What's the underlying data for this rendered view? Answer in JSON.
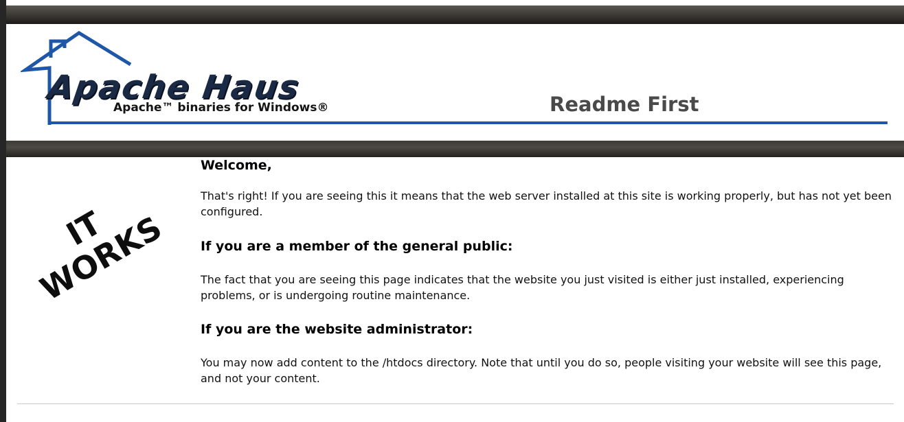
{
  "header": {
    "logo_name": "Apache Haus",
    "logo_tagline": "Apache™ binaries for Windows®",
    "title": "Readme First"
  },
  "badge": {
    "line1": "IT",
    "line2": "WORKS"
  },
  "content": {
    "welcome": "Welcome,",
    "intro": "That's right! If you are seeing this it means that the web server installed at this site is working properly, but has not yet been configured.",
    "public_heading": "If you are a member of the general public:",
    "public_text": "The fact that you are seeing this page indicates that the website you just visited is either just installed, experiencing problems, or is undergoing routine maintenance.",
    "admin_heading": "If you are the website administrator:",
    "admin_text": "You may now add content to the /htdocs directory. Note that until you do so, people visiting your website will see this page, and not your content."
  },
  "colors": {
    "accent_blue": "#1e57a8",
    "bar_dark": "#3a3733",
    "logo_navy": "#1a2a44"
  }
}
